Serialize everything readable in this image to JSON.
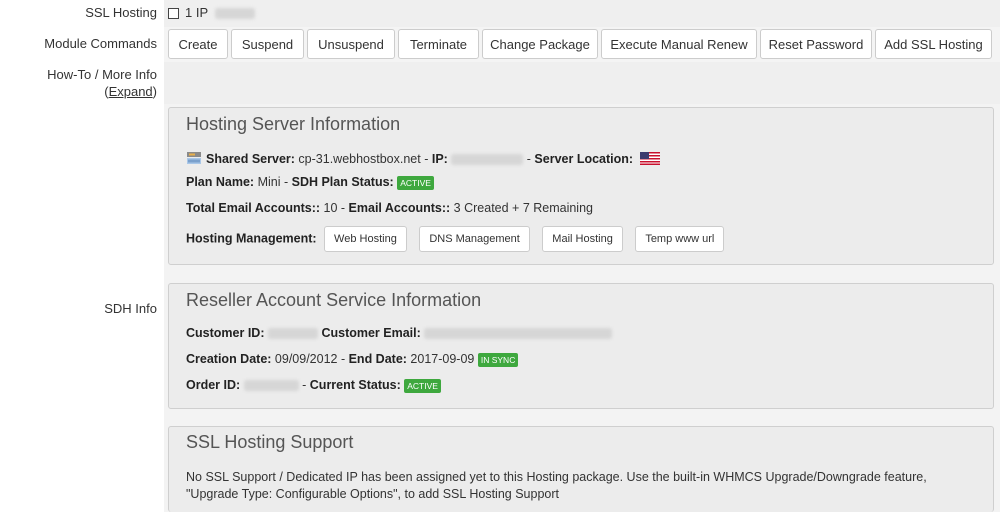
{
  "ssl_hosting": {
    "label": "SSL Hosting",
    "option_text": "1 IP"
  },
  "module_commands": {
    "label": "Module Commands",
    "buttons": [
      "Create",
      "Suspend",
      "Unsuspend",
      "Terminate",
      "Change Package",
      "Execute Manual Renew",
      "Reset Password",
      "Add SSL Hosting"
    ]
  },
  "howto": {
    "label": "How-To / More Info",
    "expand_open": "(",
    "expand_link": "Expand",
    "expand_close": ")"
  },
  "hosting_server": {
    "title": "Hosting Server Information",
    "shared_server_label": "Shared Server:",
    "shared_server_value": "cp-31.webhostbox.net",
    "ip_label": "IP:",
    "server_location_label": "Server Location:",
    "plan_name_label": "Plan Name:",
    "plan_name_value": "Mini",
    "plan_status_label": "SDH Plan Status:",
    "plan_status_badge": "ACTIVE",
    "total_email_label": "Total Email Accounts::",
    "total_email_value": "10",
    "email_accounts_label": "Email Accounts::",
    "email_accounts_value": "3 Created + 7 Remaining",
    "hosting_mgmt_label": "Hosting Management:",
    "mgmt_buttons": [
      "Web Hosting",
      "DNS Management",
      "Mail Hosting",
      "Temp www url"
    ],
    "icons": [
      "server-icon",
      "us-flag-icon"
    ]
  },
  "sdh_info": {
    "label": "SDH Info"
  },
  "reseller": {
    "title": "Reseller Account Service Information",
    "customer_id_label": "Customer ID:",
    "customer_email_label": "Customer Email:",
    "creation_date_label": "Creation Date:",
    "creation_date_value": "09/09/2012",
    "end_date_label": "End Date:",
    "end_date_value": "2017-09-09",
    "sync_badge": "IN SYNC",
    "order_id_label": "Order ID:",
    "current_status_label": "Current Status:",
    "current_status_badge": "ACTIVE"
  },
  "ssl_support": {
    "title": "SSL Hosting Support",
    "text_line1": "No SSL Support / Dedicated IP has been assigned yet to this Hosting package. Use the built-in WHMCS Upgrade/Downgrade feature,",
    "text_line2": "\"Upgrade Type: Configurable Options\", to add SSL Hosting Support"
  },
  "colors": {
    "badge_green": "#3ea83e",
    "field_bg": "#efefef",
    "panel_bg": "#ececec",
    "border": "#cccccc"
  }
}
